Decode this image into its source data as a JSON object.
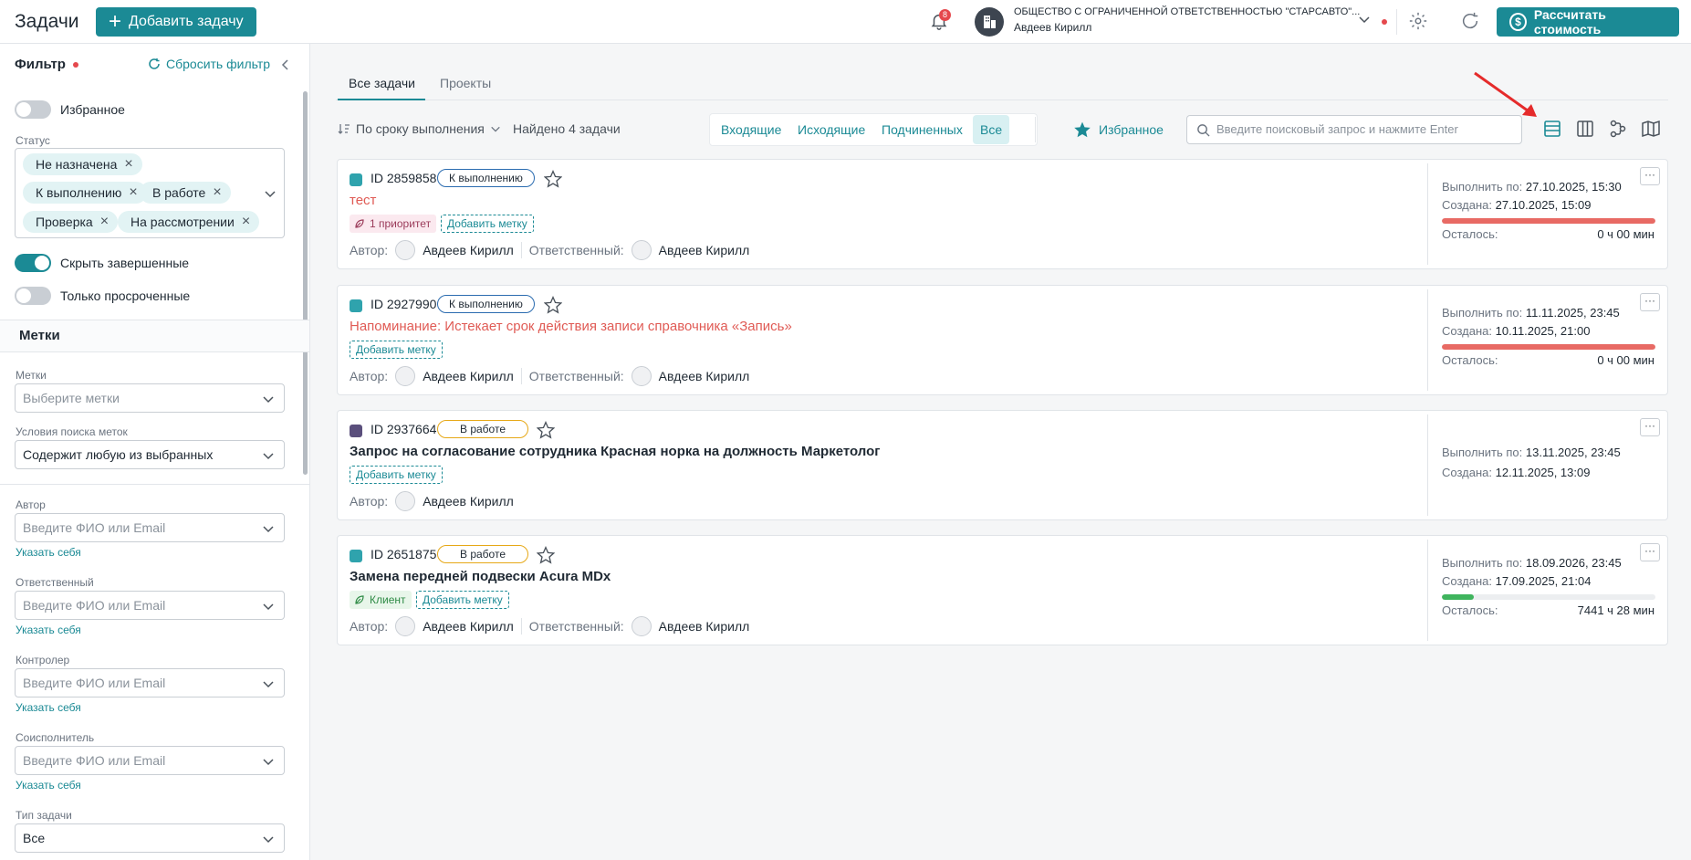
{
  "header": {
    "title": "Задачи",
    "add_button": "Добавить задачу",
    "notifications_count": "8",
    "org_name": "ОБЩЕСТВО С ОГРАНИЧЕННОЙ ОТВЕТСТВЕННОСТЬЮ \"СТАРСАВТО\"...",
    "user_name": "Авдеев Кирилл",
    "calc_button": "Рассчитать стоимость"
  },
  "sidebar": {
    "filter_title": "Фильтр",
    "reset_filter": "Сбросить фильтр",
    "favorites_label": "Избранное",
    "status_label": "Статус",
    "status_chips": [
      "Не назначена",
      "К выполнению",
      "В работе",
      "Проверка",
      "На рассмотрении"
    ],
    "hide_completed": "Скрыть завершенные",
    "only_overdue": "Только просроченные",
    "tags_section": "Метки",
    "tags_label": "Метки",
    "tags_placeholder": "Выберите метки",
    "tag_search_label": "Условия поиска меток",
    "tag_search_value": "Содержит любую из выбранных",
    "author_label": "Автор",
    "responsible_label": "Ответственный",
    "controller_label": "Контролер",
    "coexecutor_label": "Соисполнитель",
    "person_placeholder": "Введите ФИО или Email",
    "self_link": "Указать себя",
    "task_type_label": "Тип задачи",
    "task_type_value": "Все"
  },
  "tabs": [
    "Все задачи",
    "Проекты"
  ],
  "toolbar": {
    "sort_label": "По сроку выполнения",
    "found_label": "Найдено 4 задачи",
    "segments": [
      "Входящие",
      "Исходящие",
      "Подчиненных",
      "Все"
    ],
    "favorites": "Избранное",
    "search_placeholder": "Введите поисковый запрос и нажмите Enter"
  },
  "labels": {
    "author": "Автор:",
    "responsible": "Ответственный:",
    "due": "Выполнить по:",
    "created": "Создана:",
    "remaining": "Осталось:",
    "add_tag": "Добавить метку"
  },
  "tasks": [
    {
      "id": "ID 2859858",
      "status": "К выполнению",
      "title": "тест",
      "tag": "1 приоритет",
      "author": "Авдеев Кирилл",
      "responsible": "Авдеев Кирилл",
      "due": "27.10.2025, 15:30",
      "created": "27.10.2025, 15:09",
      "remaining": "0 ч 00 мин",
      "progress": 1.0
    },
    {
      "id": "ID 2927990",
      "status": "К выполнению",
      "title": "Напоминание: Истекает срок действия записи справочника «Запись»",
      "author": "Авдеев Кирилл",
      "responsible": "Авдеев Кирилл",
      "due": "11.11.2025, 23:45",
      "created": "10.11.2025, 21:00",
      "remaining": "0 ч 00 мин",
      "progress": 1.0
    },
    {
      "id": "ID 2937664",
      "status": "В работе",
      "title": "Запрос на согласование сотрудника Красная норка на должность Маркетолог",
      "author": "Авдеев Кирилл",
      "due": "13.11.2025, 23:45",
      "created": "12.11.2025, 13:09"
    },
    {
      "id": "ID 2651875",
      "status": "В работе",
      "title": "Замена передней подвески Acura MDx",
      "tag": "Клиент",
      "author": "Авдеев Кирилл",
      "responsible": "Авдеев Кирилл",
      "due": "18.09.2026, 23:45",
      "created": "17.09.2025, 21:04",
      "remaining": "7441 ч 28 мин",
      "progress": 0.15
    }
  ],
  "colors": {
    "accent": "#1b8a95",
    "overdue_bar": "#e86a64",
    "ok_bar": "#3fb45d",
    "alert_dot": "#e5484d"
  }
}
